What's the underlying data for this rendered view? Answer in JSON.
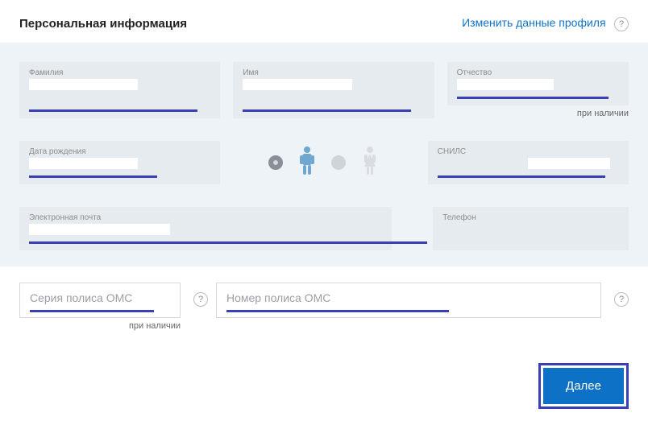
{
  "header": {
    "title": "Персональная информация",
    "edit_link": "Изменить данные профиля",
    "help": "?"
  },
  "fields": {
    "surname": {
      "label": "Фамилия"
    },
    "name": {
      "label": "Имя"
    },
    "patronymic": {
      "label": "Отчество",
      "hint": "при наличии"
    },
    "birthdate": {
      "label": "Дата рождения"
    },
    "snils": {
      "label": "СНИЛС"
    },
    "email": {
      "label": "Электронная почта"
    },
    "phone": {
      "label": "Телефон"
    }
  },
  "oms": {
    "series_placeholder": "Серия полиса ОМС",
    "number_placeholder": "Номер полиса ОМС",
    "hint": "при наличии",
    "help": "?"
  },
  "footer": {
    "next": "Далее"
  }
}
